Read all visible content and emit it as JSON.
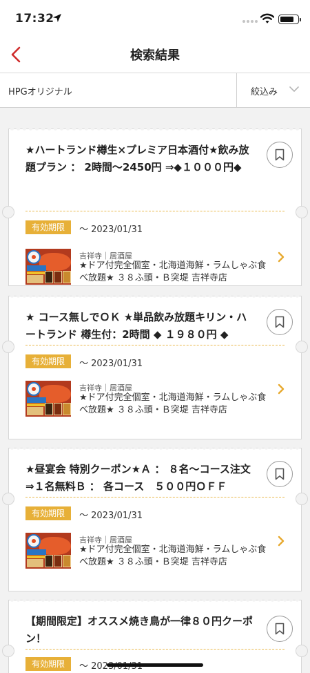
{
  "status_bar": {
    "time": "17:32"
  },
  "header": {
    "title": "検索結果",
    "back_icon": "chevron-left-icon"
  },
  "filter_bar": {
    "source": "HPGオリジナル",
    "filter_label": "絞込み"
  },
  "colors": {
    "accent": "#cf2a2a",
    "badge": "#e7b038",
    "divider": "#e9b84a",
    "chevron": "#e7a92e"
  },
  "coupons": [
    {
      "title": "★ハートランド樽生×プレミア日本酒付★飲み放題プラン ： 2時間〜2450円 ⇒◆１０００円◆",
      "expiry_label": "有効期限",
      "expiry_date": "〜 2023/01/31",
      "shop_meta": "吉祥寺｜居酒屋",
      "shop_name": "★ドア付完全個室・北海道海鮮・ラムしゃぶ食べ放題★ ３８ふ頭・Ｂ突堤 吉祥寺店"
    },
    {
      "title": "★ コース無しでＯＫ ★単品飲み放題キリン・ハートランド 樽生付：2時間 ◆ １９８０円 ◆",
      "expiry_label": "有効期限",
      "expiry_date": "〜 2023/01/31",
      "shop_meta": "吉祥寺｜居酒屋",
      "shop_name": "★ドア付完全個室・北海道海鮮・ラムしゃぶ食べ放題★ ３８ふ頭・Ｂ突堤 吉祥寺店"
    },
    {
      "title": "★昼宴会 特別クーポン★Ａ ： ８名〜コース注文⇒１名無料Ｂ ： 各コース　５００円ＯＦＦ",
      "expiry_label": "有効期限",
      "expiry_date": "〜 2023/01/31",
      "shop_meta": "吉祥寺｜居酒屋",
      "shop_name": "★ドア付完全個室・北海道海鮮・ラムしゃぶ食べ放題★ ３８ふ頭・Ｂ突堤 吉祥寺店"
    },
    {
      "title": "【期間限定】オススメ焼き鳥が一律８０円クーポン！",
      "expiry_label": "有効期限",
      "expiry_date": "〜 2023/01/31"
    }
  ]
}
